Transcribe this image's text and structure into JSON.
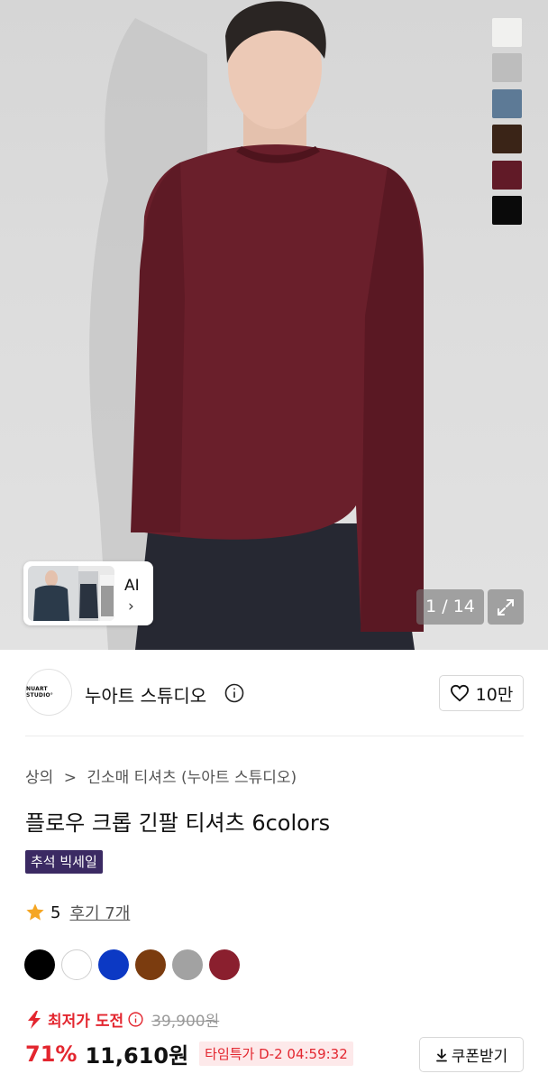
{
  "hero": {
    "swatches": [
      "#f1f1ef",
      "#bdbdbd",
      "#5d7a96",
      "#3a2417",
      "#611a27",
      "#0a0a0a"
    ],
    "ai_thumb_label": "AI",
    "ai_thumb_chevron": "›",
    "counter": "1 / 14",
    "expand_icon": "expand-icon"
  },
  "brand": {
    "logo_text": "NUART STUDIO°",
    "name": "누아트 스튜디오",
    "info_icon": "info-icon",
    "like_icon": "heart-icon",
    "like_count": "10만"
  },
  "product": {
    "breadcrumb": [
      "상의",
      ">",
      "긴소매 티셔츠 (누아트 스튜디오)"
    ],
    "title": "플로우 크롭 긴팔 티셔츠 6colors",
    "badge": "추석 빅세일",
    "rating": {
      "score": "5",
      "review_text": "후기 7개"
    },
    "color_options": [
      "#000000",
      "#ffffff",
      "#0c39c4",
      "#7b3c0f",
      "#a2a2a2",
      "#8a1f2e"
    ],
    "lowest_price_label": "최저가 도전",
    "original_price": "39,900원",
    "discount": "71%",
    "price": "11,610원",
    "timer": "타임특가 D-2 04:59:32",
    "coupon_label": "쿠폰받기"
  }
}
